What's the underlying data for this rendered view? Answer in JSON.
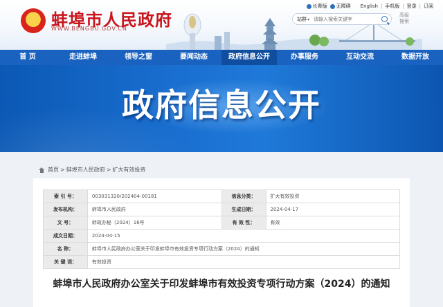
{
  "header": {
    "site_title": "蚌埠市人民政府",
    "site_url": "WWW.BENGBU.GOV.CN",
    "top_links": [
      "长辈版",
      "无障碍",
      "English",
      "手机版",
      "登录",
      "订阅"
    ],
    "search": {
      "scope": "站群",
      "placeholder": "请输入搜索关键字",
      "advanced": "高级搜索"
    }
  },
  "nav": {
    "items": [
      "首  页",
      "走进蚌埠",
      "领导之窗",
      "要闻动态",
      "政府信息公开",
      "办事服务",
      "互动交流",
      "数据开放"
    ],
    "active_index": 4
  },
  "banner": {
    "title": "政府信息公开"
  },
  "breadcrumb": [
    "首页",
    "蚌埠市人民政府",
    "扩大有效投资"
  ],
  "meta": {
    "index_label": "索 引 号：",
    "index_value": "003031320/202404-00181",
    "category_label": "信息分类：",
    "category_value": "扩大有效投资",
    "publisher_label": "发布机构：",
    "publisher_value": "蚌埠市人民政府",
    "gen_date_label": "生成日期：",
    "gen_date_value": "2024-04-17",
    "docno_label": "文    号：",
    "docno_value": "蚌政办秘〔2024〕16号",
    "validity_label": "有 效 性：",
    "validity_value": "有效",
    "effective_label": "成文日期：",
    "effective_value": "2024-04-15",
    "name_label": "名    称：",
    "name_value": "蚌埠市人民政府办公室关于印发蚌埠市有效投资专项行动方案（2024）的通知",
    "keywords_label": "关 键 词：",
    "keywords_value": "有效投资"
  },
  "doc": {
    "title": "蚌埠市人民政府办公室关于印发蚌埠市有效投资专项行动方案（2024）的通知"
  },
  "colors": {
    "nav_blue": "#1a62c0",
    "title_red": "#c9161c"
  }
}
